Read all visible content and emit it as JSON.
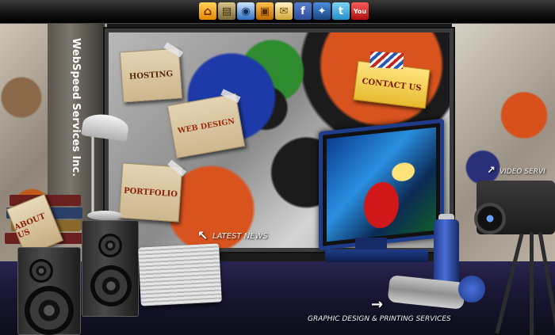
{
  "topbar": {
    "icons": [
      {
        "name": "home-icon",
        "glyph": "⌂"
      },
      {
        "name": "film-icon",
        "glyph": "▤"
      },
      {
        "name": "database-icon",
        "glyph": "◉"
      },
      {
        "name": "briefcase-icon",
        "glyph": "▣"
      },
      {
        "name": "mail-icon",
        "glyph": "✉"
      },
      {
        "name": "facebook-icon",
        "glyph": "f"
      },
      {
        "name": "myspace-icon",
        "glyph": "✦"
      },
      {
        "name": "twitter-icon",
        "glyph": "t"
      },
      {
        "name": "youtube-icon",
        "glyph": "You"
      }
    ]
  },
  "brand": {
    "name": "WebSpeed Services Inc."
  },
  "notes": {
    "hosting": "HOSTING",
    "web_design": "WEB DESIGN",
    "portfolio": "PORTFOLIO",
    "contact_us": "CONTACT US",
    "about_us": "ABOUT US"
  },
  "links": {
    "latest_news": "LATEST NEWS",
    "video_services": "VIDEO SERVI",
    "graphic_design": "GRAPHIC DESIGN & PRINTING SERVICES"
  },
  "glyphs": {
    "arrow_up_left": "↖",
    "arrow_right": "→",
    "arrow_up_right": "↗"
  }
}
